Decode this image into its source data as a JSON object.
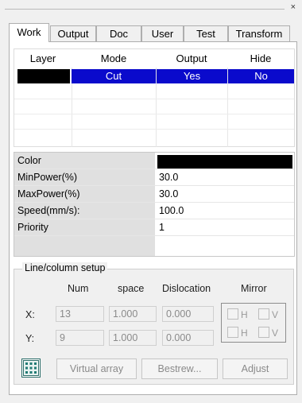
{
  "window": {
    "close_glyph": "×"
  },
  "tabs": [
    "Work",
    "Output",
    "Doc",
    "User",
    "Test",
    "Transform"
  ],
  "layers": {
    "headers": [
      "Layer",
      "Mode",
      "Output",
      "Hide"
    ],
    "rows": [
      {
        "layer_color": "#000000",
        "mode": "Cut",
        "output": "Yes",
        "hide": "No"
      }
    ],
    "selection_color": "#0a0acc"
  },
  "props": {
    "color_label": "Color",
    "color_value": "#000000",
    "rows": [
      {
        "label": "MinPower(%)",
        "value": "30.0"
      },
      {
        "label": "MaxPower(%)",
        "value": "30.0"
      },
      {
        "label": "Speed(mm/s):",
        "value": "100.0"
      },
      {
        "label": "Priority",
        "value": "1"
      }
    ]
  },
  "line_column": {
    "title": "Line/column setup",
    "headers": {
      "num": "Num",
      "space": "space",
      "dislocation": "Dislocation",
      "mirror": "Mirror"
    },
    "x": {
      "label": "X:",
      "num": "13",
      "space": "1.000",
      "dislocation": "0.000",
      "h": "H",
      "v": "V"
    },
    "y": {
      "label": "Y:",
      "num": "9",
      "space": "1.000",
      "dislocation": "0.000",
      "h": "H",
      "v": "V"
    },
    "buttons": {
      "virtual_array": "Virtual array",
      "bestrew": "Bestrew...",
      "adjust": "Adjust"
    },
    "array_icon": "grid-array-icon"
  }
}
